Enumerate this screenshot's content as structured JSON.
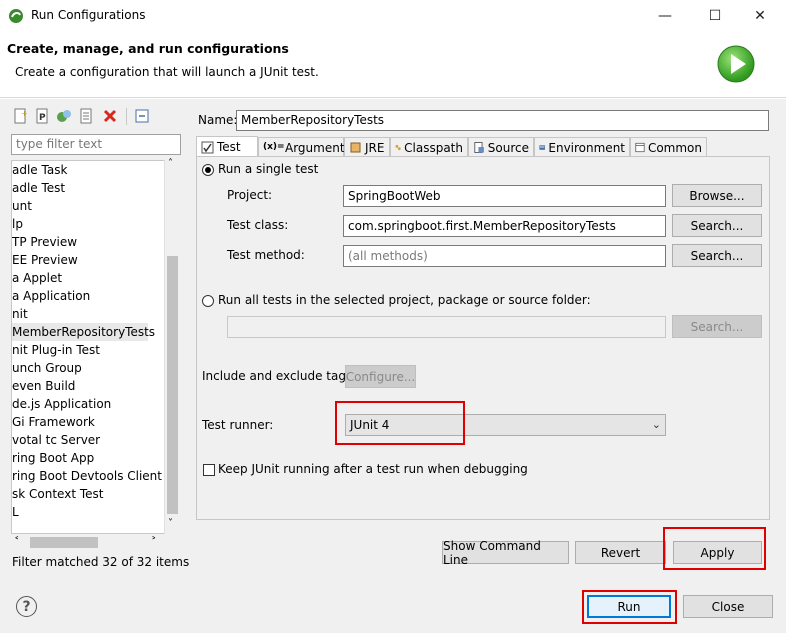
{
  "window": {
    "title": "Run Configurations",
    "controls": [
      "minimize-icon",
      "maximize-icon",
      "close-icon"
    ]
  },
  "banner": {
    "title": "Create, manage, and run configurations",
    "subtitle": "Create a configuration that will launch a JUnit test."
  },
  "sidebar": {
    "toolbar_icons": [
      "new-config-icon",
      "new-prototype-icon",
      "duplicate-icon",
      "export-icon",
      "delete-icon",
      "collapse-all-icon"
    ],
    "filter_placeholder": "type filter text",
    "items": [
      "adle Task",
      "adle Test",
      "unt",
      "lp",
      "TP Preview",
      "EE Preview",
      "a Applet",
      "a Application",
      "nit",
      "MemberRepositoryTests",
      "nit Plug-in Test",
      "unch Group",
      "even Build",
      "de.js Application",
      "Gi Framework",
      "votal tc Server",
      "ring Boot App",
      "ring Boot Devtools Client",
      "sk Context Test",
      "L"
    ],
    "selected_index": 9,
    "filter_status": "Filter matched 32 of 32 items"
  },
  "config": {
    "name_label": "Name:",
    "name_value": "MemberRepositoryTests",
    "tabs": [
      {
        "label": "Test",
        "icon": "test-icon"
      },
      {
        "label": "Arguments",
        "icon": "arguments-icon"
      },
      {
        "label": "JRE",
        "icon": "jre-icon"
      },
      {
        "label": "Classpath",
        "icon": "classpath-icon"
      },
      {
        "label": "Source",
        "icon": "source-icon"
      },
      {
        "label": "Environment",
        "icon": "environment-icon"
      },
      {
        "label": "Common",
        "icon": "common-icon"
      }
    ],
    "active_tab": "Test",
    "single_test_label": "Run a single test",
    "project_label": "Project:",
    "project_value": "SpringBootWeb",
    "browse_label": "Browse...",
    "test_class_label": "Test class:",
    "test_class_value": "com.springboot.first.MemberRepositoryTests",
    "search_label": "Search...",
    "test_method_label": "Test method:",
    "test_method_placeholder": "(all methods)",
    "search_method_label": "Search...",
    "run_all_label": "Run all tests in the selected project, package or source folder:",
    "search_disabled_label": "Search...",
    "tags_label": "Include and exclude tags:",
    "configure_label": "Configure...",
    "runner_label": "Test runner:",
    "runner_value": "JUnit 4",
    "keep_running_label": "Keep JUnit running after a test run when debugging"
  },
  "actions": {
    "show_command_line": "Show Command Line",
    "revert": "Revert",
    "apply": "Apply",
    "run": "Run",
    "close": "Close"
  },
  "colors": {
    "highlight": "#e00000",
    "run_focus": "#0078d7"
  }
}
